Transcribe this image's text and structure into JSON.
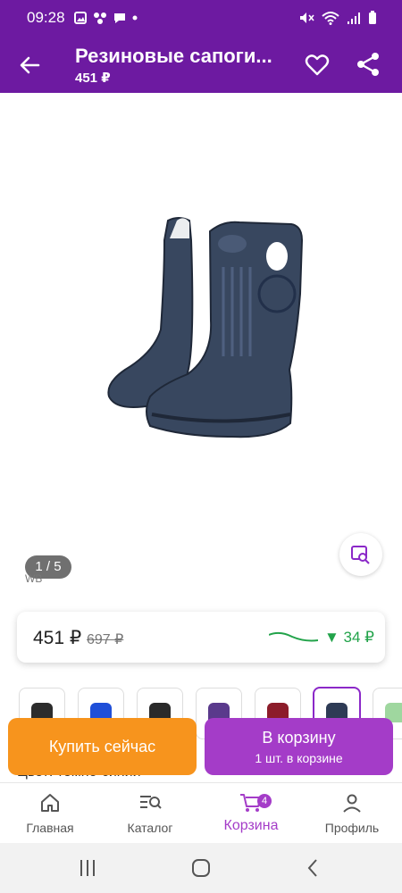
{
  "status_bar": {
    "time": "09:28"
  },
  "app_bar": {
    "title": "Резиновые сапоги...",
    "subtitle": "451 ₽"
  },
  "gallery": {
    "counter": "1 / 5",
    "watermark": "WB"
  },
  "price_card": {
    "price": "451 ₽",
    "old_price": "697 ₽",
    "drop": "▼ 34 ₽"
  },
  "color_variants": [
    {
      "color": "#2c2c2c"
    },
    {
      "color": "#1f4fd8"
    },
    {
      "color": "#2a2a2a"
    },
    {
      "color": "#5a3a8c"
    },
    {
      "color": "#8c1c2a"
    },
    {
      "color": "#2e3b55",
      "selected": true
    },
    {
      "color": "#9fd79f"
    }
  ],
  "color_label": "Цвет: темно-синий",
  "actions": {
    "buy_now": "Купить сейчас",
    "add_to_cart": "В корзину",
    "in_cart": "1 шт. в корзине"
  },
  "bottom_nav": {
    "items": [
      {
        "label": "Главная"
      },
      {
        "label": "Каталог"
      },
      {
        "label": "Корзина",
        "badge": "4",
        "active": true
      },
      {
        "label": "Профиль"
      }
    ]
  },
  "colors": {
    "brand": "#6d1aa1",
    "accent": "#a43cc8",
    "buy": "#f7941d",
    "price_drop": "#22a34a"
  }
}
